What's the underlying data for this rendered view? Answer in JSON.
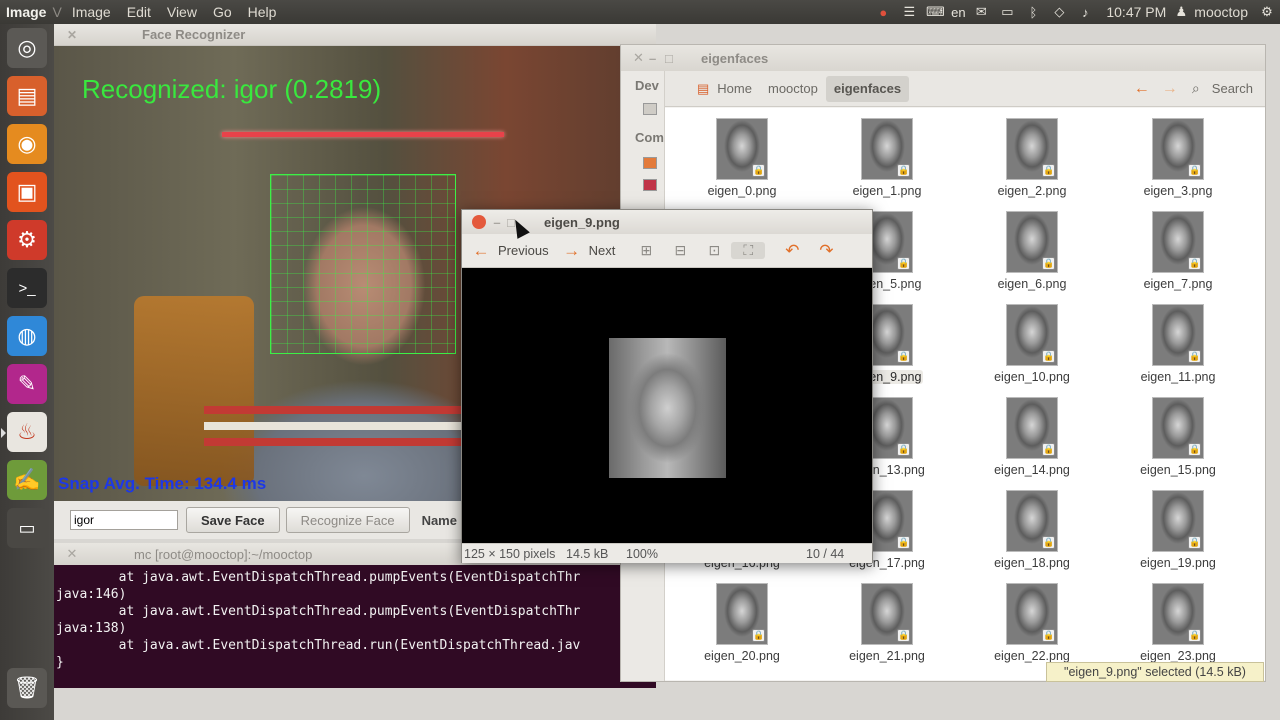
{
  "topbar": {
    "app_name": "Image",
    "app_subtitle": "V",
    "menus": [
      "Image",
      "Edit",
      "View",
      "Go",
      "Help"
    ],
    "keyboard_layout": "en",
    "clock": "10:47 PM",
    "user": "mooctop"
  },
  "launcher": {
    "items": [
      "dash-home",
      "files",
      "firefox",
      "software-center",
      "system-settings",
      "terminal",
      "chrome",
      "screen-recorder",
      "java",
      "text-editor",
      "workspace-switcher",
      "trash"
    ]
  },
  "face_window": {
    "title": "Face Recognizer",
    "recognized_text": "Recognized: igor (0.2819)",
    "snap_text": "Snap Avg. Time:  134.4 ms",
    "name_input_value": "igor",
    "save_button": "Save Face",
    "recognize_button": "Recognize Face",
    "name_label": "Name"
  },
  "terminal": {
    "title": "mc [root@mooctop]:~/mooctop",
    "lines": [
      "        at java.awt.EventDispatchThread.pumpEvents(EventDispatchThr",
      "java:146)",
      "        at java.awt.EventDispatchThread.pumpEvents(EventDispatchThr",
      "java:138)",
      "        at java.awt.EventDispatchThread.run(EventDispatchThread.jav",
      "}"
    ]
  },
  "file_manager": {
    "title": "eigenfaces",
    "sidebar_labels": [
      "Dev",
      "Com"
    ],
    "breadcrumbs": [
      "Home",
      "mooctop",
      "eigenfaces"
    ],
    "search_label": "Search",
    "files": [
      "eigen_0.png",
      "eigen_1.png",
      "eigen_2.png",
      "eigen_3.png",
      "",
      "eigen_5.png",
      "eigen_6.png",
      "eigen_7.png",
      "",
      "eigen_9.png",
      "eigen_10.png",
      "eigen_11.png",
      "",
      "eigen_13.png",
      "eigen_14.png",
      "eigen_15.png",
      "eigen_16.png",
      "eigen_17.png",
      "eigen_18.png",
      "eigen_19.png",
      "eigen_20.png",
      "eigen_21.png",
      "eigen_22.png",
      "eigen_23.png"
    ],
    "selected_file": "eigen_9.png",
    "status": "\"eigen_9.png\" selected (14.5 kB)"
  },
  "image_viewer": {
    "title": "eigen_9.png",
    "previous_label": "Previous",
    "next_label": "Next",
    "status_dims": "125 × 150 pixels",
    "status_size": "14.5 kB",
    "status_zoom": "100%",
    "status_index": "10 / 44"
  },
  "colors": {
    "accent_green": "#39e83e",
    "snap_blue": "#1d38e6",
    "terminal_bg": "#300a24",
    "orange_arrow": "#e1702a"
  }
}
